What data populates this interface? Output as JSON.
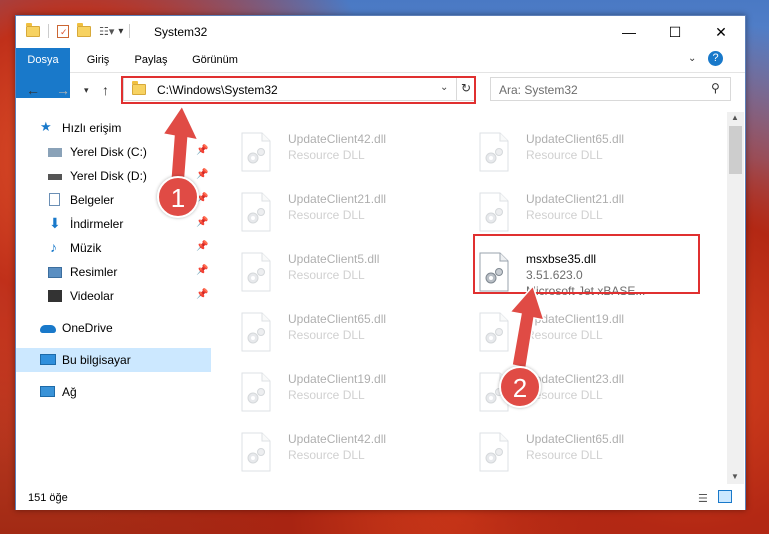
{
  "window": {
    "title": "System32"
  },
  "ribbon": {
    "tabs": [
      "Dosya",
      "Giriş",
      "Paylaş",
      "Görünüm"
    ]
  },
  "address": {
    "path": "C:\\Windows\\System32"
  },
  "search": {
    "placeholder": "Ara: System32"
  },
  "sidebar": {
    "items": [
      {
        "label": "Hızlı erişim",
        "icon": "star-icon"
      },
      {
        "label": "Yerel Disk (C:)",
        "icon": "drive-icon"
      },
      {
        "label": "Yerel Disk (D:)",
        "icon": "drive-icon"
      },
      {
        "label": "Belgeler",
        "icon": "document-icon"
      },
      {
        "label": "İndirmeler",
        "icon": "download-icon"
      },
      {
        "label": "Müzik",
        "icon": "music-icon"
      },
      {
        "label": "Resimler",
        "icon": "pictures-icon"
      },
      {
        "label": "Videolar",
        "icon": "video-icon"
      },
      {
        "label": "OneDrive",
        "icon": "cloud-icon"
      },
      {
        "label": "Bu bilgisayar",
        "icon": "computer-icon"
      },
      {
        "label": "Ağ",
        "icon": "network-icon"
      }
    ]
  },
  "files": [
    {
      "name": "UpdateClient42.dll",
      "sub1": "Resource DLL",
      "sub2": ""
    },
    {
      "name": "UpdateClient65.dll",
      "sub1": "Resource DLL",
      "sub2": ""
    },
    {
      "name": "UpdateClient21.dll",
      "sub1": "Resource DLL",
      "sub2": ""
    },
    {
      "name": "UpdateClient21.dll",
      "sub1": "Resource DLL",
      "sub2": ""
    },
    {
      "name": "UpdateClient5.dll",
      "sub1": "Resource DLL",
      "sub2": ""
    },
    {
      "name": "msxbse35.dll",
      "sub1": "3.51.623.0",
      "sub2": "Microsoft Jet xBASE..."
    },
    {
      "name": "UpdateClient65.dll",
      "sub1": "Resource DLL",
      "sub2": ""
    },
    {
      "name": "UpdateClient19.dll",
      "sub1": "Resource DLL",
      "sub2": ""
    },
    {
      "name": "UpdateClient19.dll",
      "sub1": "Resource DLL",
      "sub2": ""
    },
    {
      "name": "UpdateClient23.dll",
      "sub1": "Resource DLL",
      "sub2": ""
    },
    {
      "name": "UpdateClient42.dll",
      "sub1": "Resource DLL",
      "sub2": ""
    },
    {
      "name": "UpdateClient65.dll",
      "sub1": "Resource DLL",
      "sub2": ""
    }
  ],
  "status": {
    "count": "151 öğe"
  },
  "annotations": {
    "badge1": "1",
    "badge2": "2"
  },
  "colors": {
    "accent": "#1979ca",
    "highlight": "#e03030",
    "selected": "#cce8ff"
  }
}
